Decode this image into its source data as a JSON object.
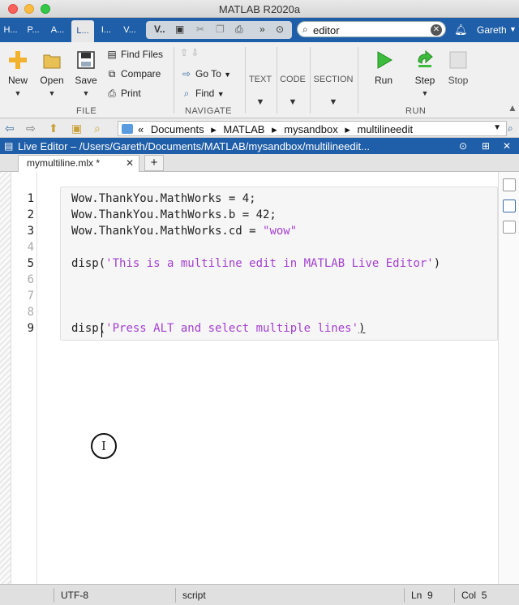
{
  "window": {
    "title": "MATLAB R2020a"
  },
  "toolstrip_tabs": [
    "H...",
    "P...",
    "A...",
    "L...",
    "I...",
    "V..."
  ],
  "quick_access": {
    "label": "V.."
  },
  "search": {
    "value": "editor"
  },
  "user": {
    "name": "Gareth"
  },
  "ribbon": {
    "file": {
      "new": "New",
      "open": "Open",
      "save": "Save",
      "find_files": "Find Files",
      "compare": "Compare",
      "print": "Print",
      "section": "FILE"
    },
    "navigate": {
      "go_to": "Go To",
      "find": "Find",
      "section": "NAVIGATE"
    },
    "text": "TEXT",
    "code": "CODE",
    "section_group": "SECTION",
    "run": {
      "run": "Run",
      "step": "Step",
      "stop": "Stop",
      "section": "RUN"
    }
  },
  "address": {
    "crumbs": [
      "«",
      "Documents",
      "▸",
      "MATLAB",
      "▸",
      "mysandbox",
      "▸",
      "multilineedit"
    ]
  },
  "editor_panel": {
    "title": "Live Editor – /Users/Gareth/Documents/MATLAB/mysandbox/multilineedit..."
  },
  "file_tab": {
    "name": "mymultiline.mlx *"
  },
  "code": {
    "lines": [
      "1",
      "2",
      "3",
      "4",
      "5",
      "6",
      "7",
      "8",
      "9"
    ],
    "l1": "Wow.ThankYou.MathWorks = 4;",
    "l2": "Wow.ThankYou.MathWorks.b = 42;",
    "l3_code": "Wow.ThankYou.MathWorks.cd = ",
    "l3_str": "\"wow\"",
    "l5_fn": "disp(",
    "l5_str": "'This is a multiline edit in MATLAB Live Editor'",
    "l5_end": ")",
    "l9_fn": "disp(",
    "l9_str": "'Press ALT and select multiple lines'",
    "l9_end": ")"
  },
  "status": {
    "encoding": "UTF-8",
    "type": "script",
    "ln_label": "Ln",
    "ln": "9",
    "col_label": "Col",
    "col": "5"
  },
  "colors": {
    "accent": "#1f5ea8",
    "string": "#a33fd0"
  }
}
